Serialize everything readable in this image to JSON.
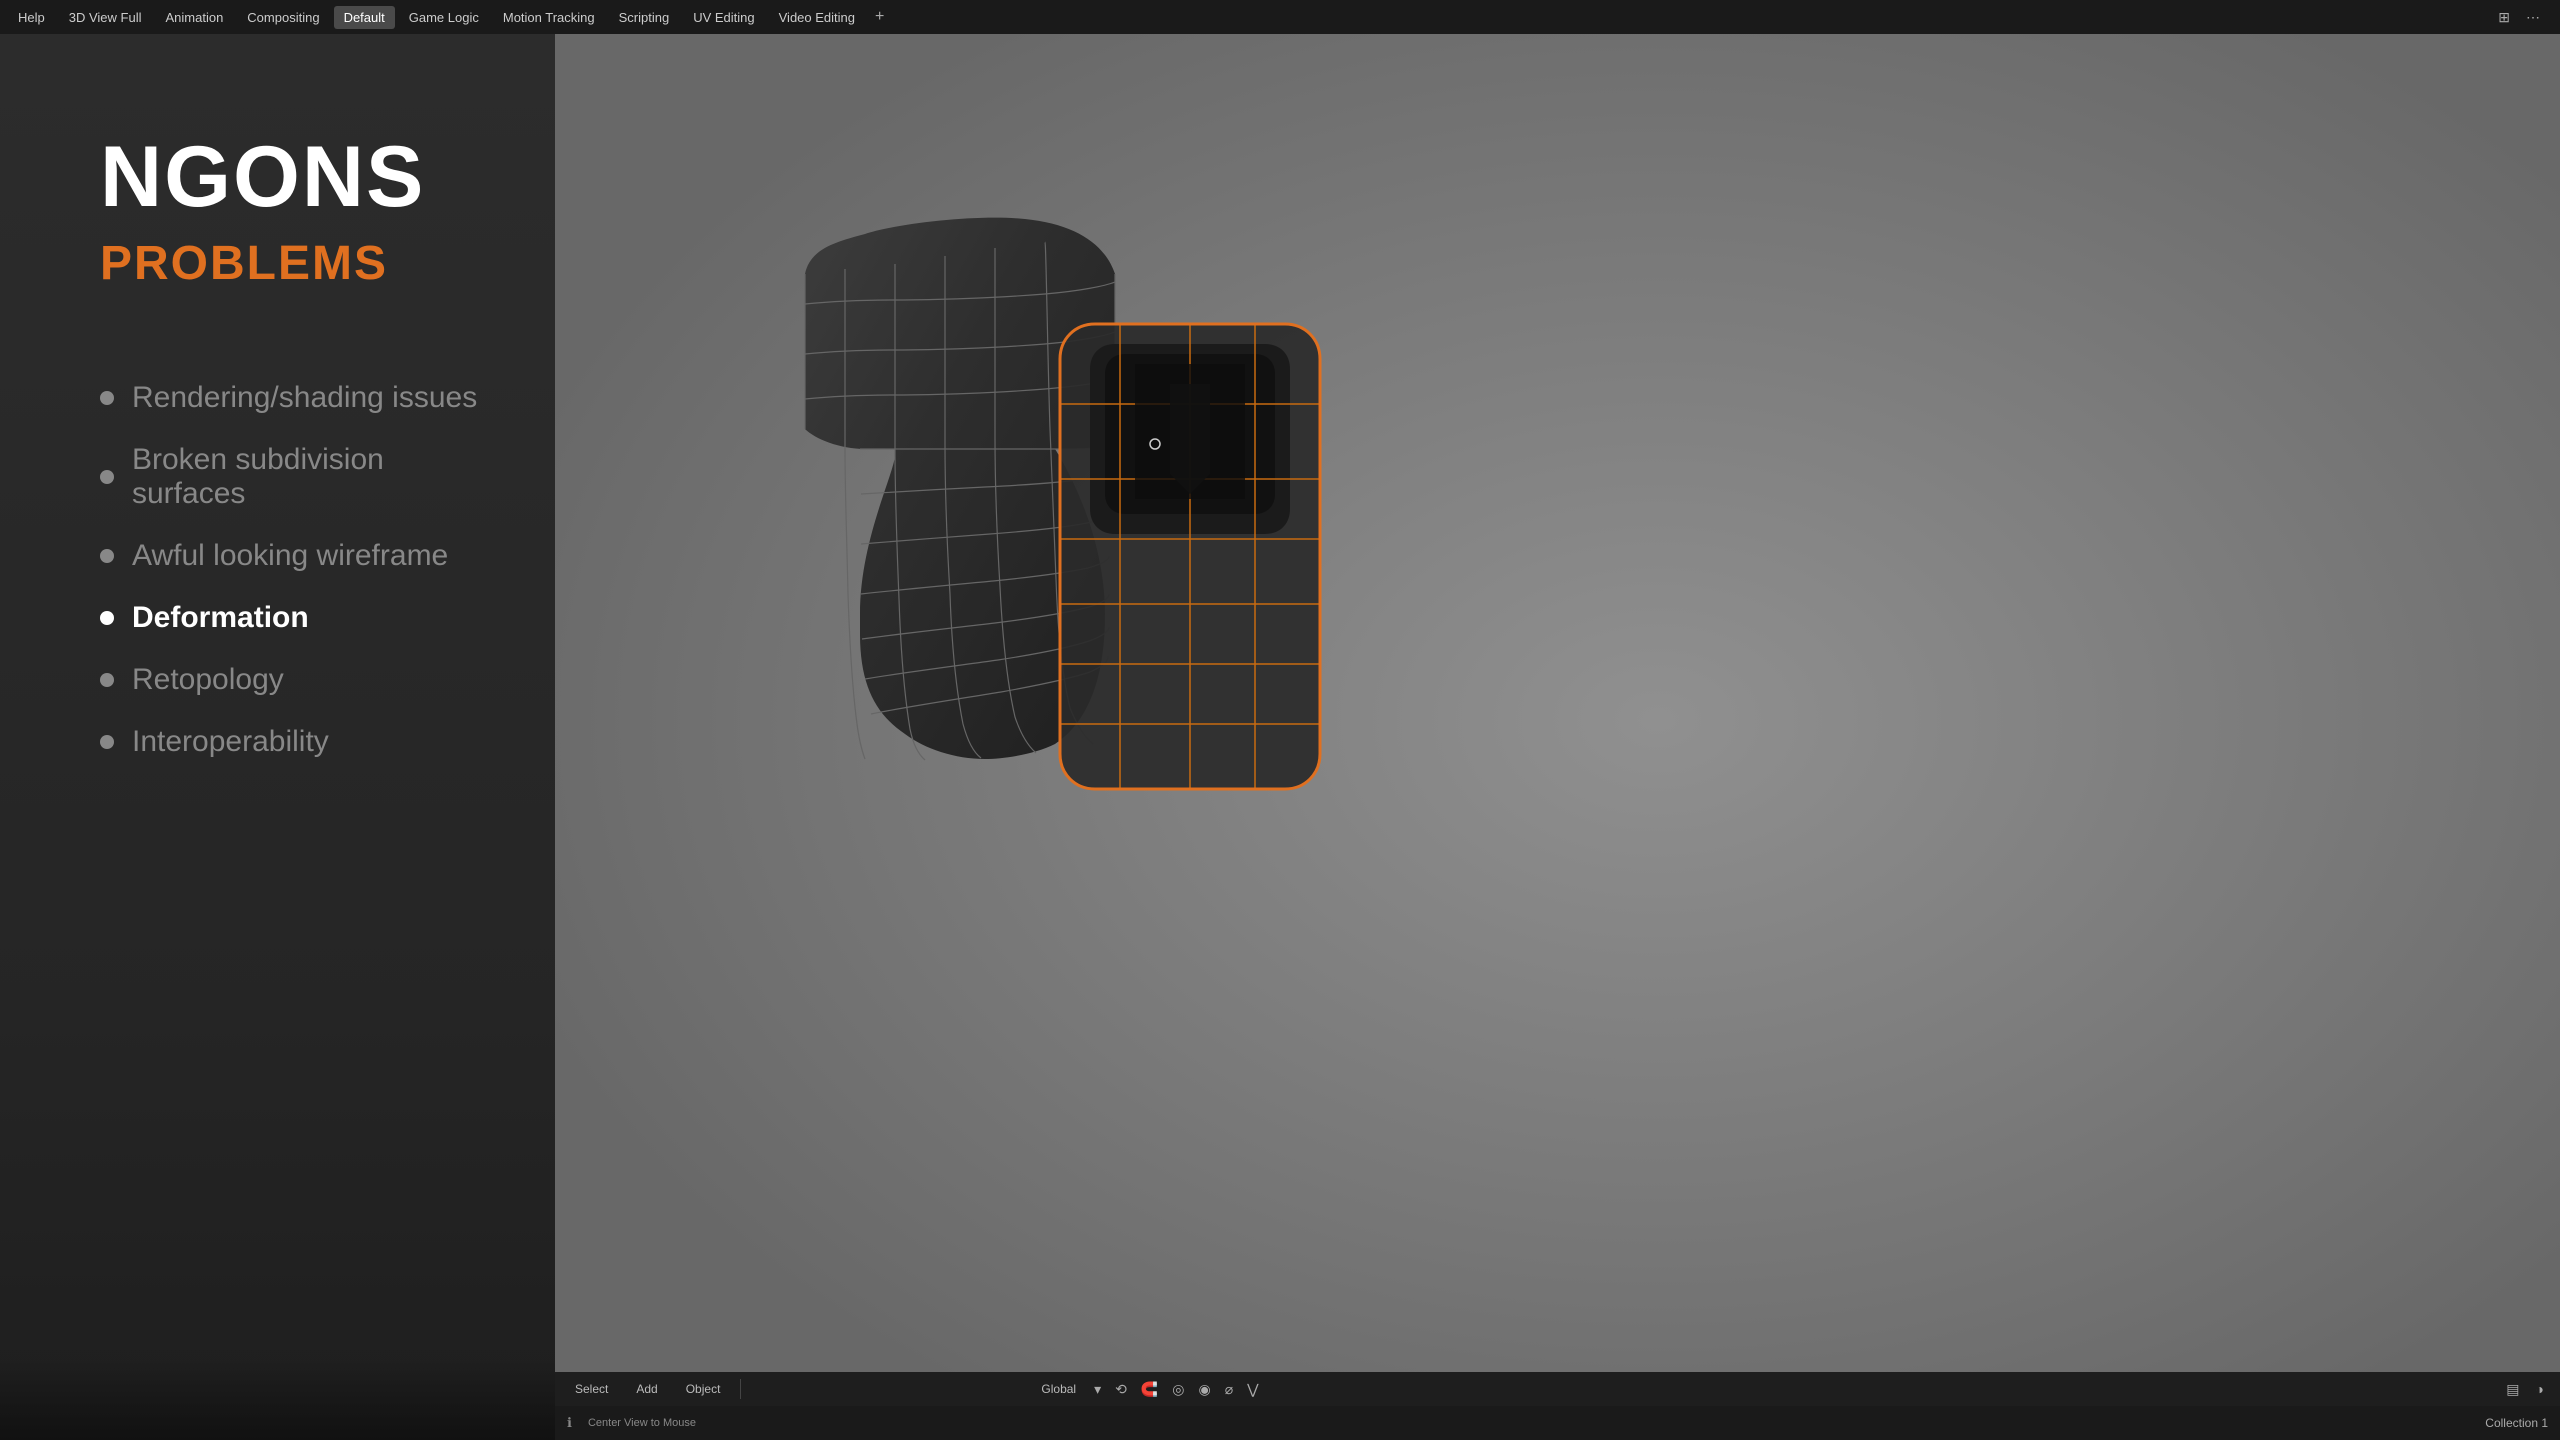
{
  "menubar": {
    "items": [
      {
        "label": "Help",
        "active": false
      },
      {
        "label": "3D View Full",
        "active": false
      },
      {
        "label": "Animation",
        "active": false
      },
      {
        "label": "Compositing",
        "active": false
      },
      {
        "label": "Default",
        "active": true
      },
      {
        "label": "Game Logic",
        "active": false
      },
      {
        "label": "Motion Tracking",
        "active": false
      },
      {
        "label": "Scripting",
        "active": false
      },
      {
        "label": "UV Editing",
        "active": false
      },
      {
        "label": "Video Editing",
        "active": false
      }
    ],
    "plus_label": "+",
    "icons": [
      "grid-icon",
      "dots-icon"
    ]
  },
  "slide": {
    "title": "NGONS",
    "subtitle": "PROBLEMS",
    "bullets": [
      {
        "text": "Rendering/shading issues",
        "active": false
      },
      {
        "text": "Broken subdivision surfaces",
        "active": false
      },
      {
        "text": "Awful looking wireframe",
        "active": false
      },
      {
        "text": "Deformation",
        "active": true
      },
      {
        "text": "Retopology",
        "active": false
      },
      {
        "text": "Interoperability",
        "active": false
      }
    ]
  },
  "viewport_controls": {
    "select_label": "Select",
    "add_label": "Add",
    "object_label": "Object",
    "global_label": "Global",
    "icons": [
      "transform-icon",
      "snap-icon",
      "pivot-icon",
      "shading-icon",
      "proportional-icon",
      "filter-icon"
    ],
    "right_icons": [
      "layer-icon",
      "render-icon"
    ]
  },
  "status_bar": {
    "message": "Center View to Mouse",
    "icon": "info-icon",
    "collection": "Collection 1"
  },
  "colors": {
    "accent": "#e07020",
    "active_mesh_outline": "#e07020",
    "mesh_body": "#2a2a2a",
    "mesh_wire": "#555555",
    "background": "#7a7a7a"
  }
}
